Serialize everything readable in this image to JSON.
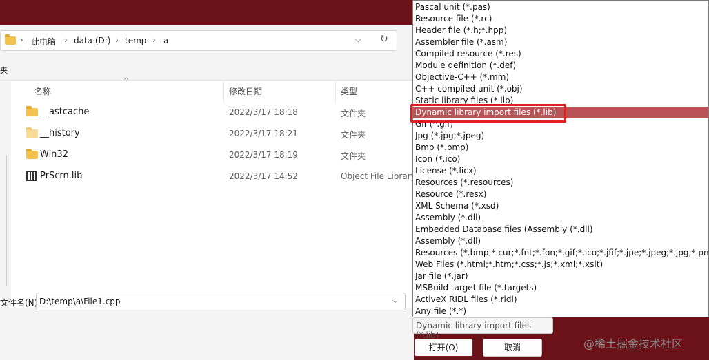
{
  "breadcrumb": [
    "此电脑",
    "data (D:)",
    "temp",
    "a"
  ],
  "toolbar_fragment": "夹",
  "columns": {
    "name": "名称",
    "date": "修改日期",
    "type": "类型"
  },
  "files": [
    {
      "name": "__astcache",
      "date": "2022/3/17 18:18",
      "type": "文件夹",
      "icon": "folder-icon"
    },
    {
      "name": "__history",
      "date": "2022/3/17 18:21",
      "type": "文件夹",
      "icon": "folder-icon"
    },
    {
      "name": "Win32",
      "date": "2022/3/17 18:19",
      "type": "文件夹",
      "icon": "folder-icon"
    },
    {
      "name": "PrScrn.lib",
      "date": "2022/3/17 14:52",
      "type": "Object File Library",
      "icon": "library-file-icon"
    }
  ],
  "filename_label": "文件名(N):",
  "filename_value": "D:\\temp\\a\\File1.cpp",
  "filetype_selected": "Dynamic library import files (*.lib)",
  "buttons": {
    "open": "打开(O)",
    "cancel": "取消"
  },
  "filetype_options": [
    "Pascal unit (*.pas)",
    "Resource file (*.rc)",
    "Header file (*.h;*.hpp)",
    "Assembler file (*.asm)",
    "Compiled resource (*.res)",
    "Module definition (*.def)",
    "Objective-C++ (*.mm)",
    "C++ compiled unit (*.obj)",
    "Static library files (*.lib)",
    "Dynamic library import files (*.lib)",
    "Gif (*.gif)",
    "Jpg (*.jpg;*.jpeg)",
    "Bmp (*.bmp)",
    "Icon (*.ico)",
    "License (*.licx)",
    "Resources (*.resources)",
    "Resource (*.resx)",
    "XML Schema (*.xsd)",
    "Assembly (*.dll)",
    "Embedded Database files (Assembly (*.dll)",
    "Assembly (*.dll)",
    "Resources (*.bmp;*.cur;*.fnt;*.fon;*.gif;*.ico;*.jfif;*.jpe;*.jpeg;*.jpg;*.png;*.ttf)",
    "Web Files (*.html;*.htm;*.css;*.js;*.xml;*.xslt)",
    "Jar file (*.jar)",
    "MSBuild target file (*.targets)",
    "ActiveX RIDL files (*.ridl)",
    "Any file (*.*)"
  ],
  "highlighted_option_index": 9,
  "colors": {
    "titlebar": "#6b1219",
    "highlight": "#b85457",
    "annotation": "#e02020"
  },
  "watermark": "@稀土掘金技术社区"
}
